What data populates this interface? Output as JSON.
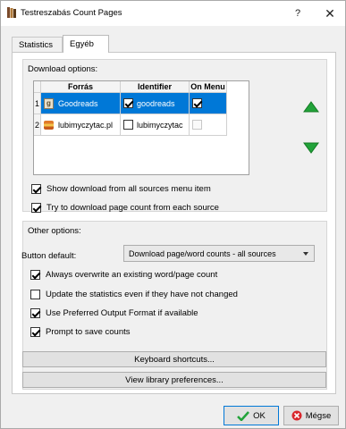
{
  "window": {
    "title": "Testreszabás Count Pages",
    "help_label": "?",
    "close_label": "✕"
  },
  "tabs": [
    {
      "label": "Statistics"
    },
    {
      "label": "Egyéb"
    }
  ],
  "download_options": {
    "title": "Download options:",
    "columns": [
      "Forrás",
      "Identifier",
      "On Menu"
    ],
    "rows": [
      {
        "num": "1",
        "source": "Goodreads",
        "source_icon": "goodreads-icon",
        "identifier": "goodreads",
        "identifier_checked": true,
        "on_menu": true,
        "selected": true
      },
      {
        "num": "2",
        "source": "lubimyczytac.pl",
        "source_icon": "books-icon",
        "identifier": "lubimyczytac",
        "identifier_checked": false,
        "on_menu": false,
        "selected": false
      }
    ],
    "move_up_icon": "arrow-up-icon",
    "move_down_icon": "arrow-down-icon",
    "show_all_sources_label": "Show download from all sources menu item",
    "show_all_sources_checked": true,
    "try_each_source_label": "Try to download page count from each source",
    "try_each_source_checked": true
  },
  "other_options": {
    "title": "Other options:",
    "button_default_label": "Button default:",
    "button_default_value": "Download page/word counts - all sources",
    "overwrite_label": "Always overwrite an existing word/page count",
    "overwrite_checked": true,
    "update_stats_label": "Update the statistics even if they have not changed",
    "update_stats_checked": false,
    "preferred_format_label": "Use Preferred Output Format if available",
    "preferred_format_checked": true,
    "prompt_save_label": "Prompt to save counts",
    "prompt_save_checked": true
  },
  "buttons": {
    "keyboard_shortcuts": "Keyboard shortcuts...",
    "view_library_prefs": "View library preferences...",
    "ok": "OK",
    "cancel": "Mégse"
  },
  "colors": {
    "selection": "#0078d7",
    "arrow_green": "#22a33a",
    "cancel_red": "#d9262c"
  }
}
